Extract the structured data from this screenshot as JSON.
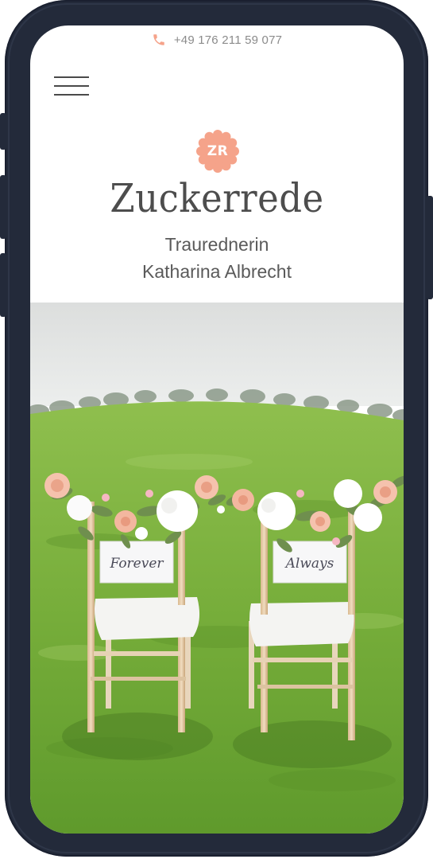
{
  "header": {
    "phone_number": "+49 176 211 59 077",
    "phone_icon": "phone-icon",
    "menu_icon": "hamburger-menu-icon"
  },
  "brand": {
    "logo_initials": "ZR",
    "name": "Zuckerrede",
    "subtitle_line1": "Traurednerin",
    "subtitle_line2": "Katharina Albrecht"
  },
  "hero": {
    "sign_left": "Forever",
    "sign_right": "Always"
  },
  "colors": {
    "accent": "#f5a38a",
    "frame": "#232a3a",
    "text": "#4d4d4d"
  }
}
